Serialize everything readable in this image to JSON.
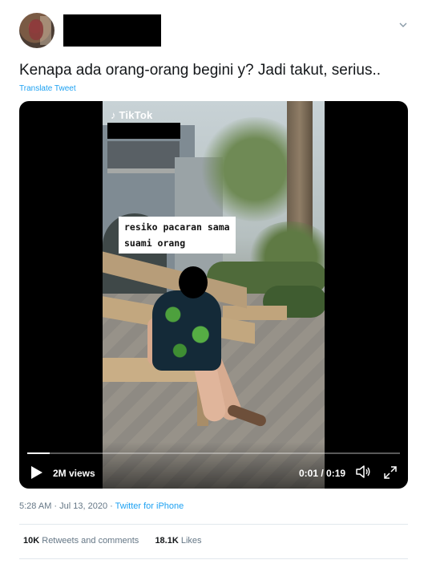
{
  "tweet": {
    "text": "Kenapa ada orang-orang begini y? Jadi takut, serius..",
    "translate_label": "Translate Tweet",
    "timestamp": "5:28 AM · Jul 13, 2020",
    "separator": " · ",
    "client": "Twitter for iPhone"
  },
  "media": {
    "watermark": "TikTok",
    "caption_line1": "resiko pacaran sama",
    "caption_line2": "suami orang",
    "views": "2M views",
    "time": "0:01 / 0:19",
    "progress_fraction": 0.06
  },
  "stats": {
    "retweets_count": "10K",
    "retweets_label": "Retweets and comments",
    "likes_count": "18.1K",
    "likes_label": "Likes"
  },
  "icons": {
    "menu": "chevron-down-icon",
    "play": "play-icon",
    "volume": "volume-icon",
    "fullscreen": "expand-icon"
  },
  "colors": {
    "link": "#1da1f2",
    "text": "#14171a",
    "secondary": "#657786"
  }
}
